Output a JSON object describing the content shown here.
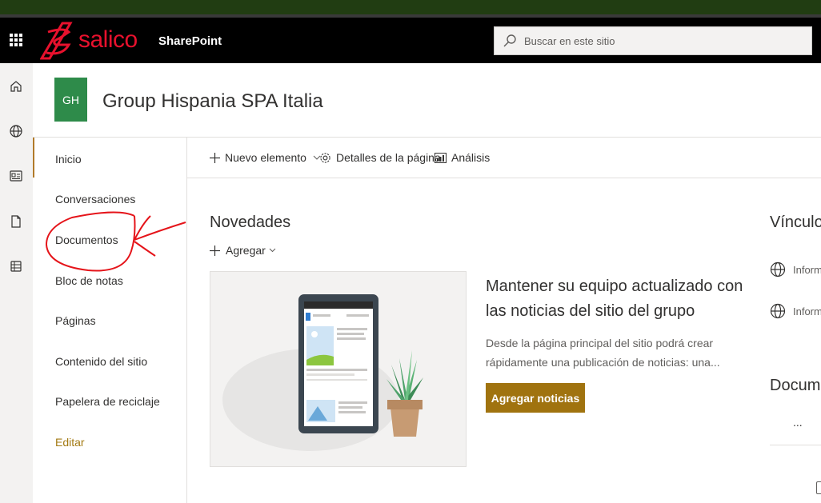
{
  "suite_bar": {
    "brand": "salico",
    "product": "SharePoint",
    "search_placeholder": "Buscar en este sitio",
    "brand_color": "#e8112d"
  },
  "app_bar": {
    "icons": [
      "home-icon",
      "globe-icon",
      "news-icon",
      "file-icon",
      "lists-icon"
    ]
  },
  "site": {
    "logo_initials": "GH",
    "title": "Group Hispania SPA Italia",
    "logo_color": "#2e8b4a"
  },
  "left_nav": {
    "items": [
      {
        "label": "Inicio",
        "selected": true
      },
      {
        "label": "Conversaciones"
      },
      {
        "label": "Documentos"
      },
      {
        "label": "Bloc de notas"
      },
      {
        "label": "Páginas"
      },
      {
        "label": "Contenido del sitio"
      },
      {
        "label": "Papelera de reciclaje"
      }
    ],
    "edit_label": "Editar",
    "accent_color": "#b17a2a"
  },
  "command_bar": {
    "new_item": "Nuevo elemento",
    "page_details": "Detalles de la página",
    "analytics": "Análisis"
  },
  "news": {
    "title": "Novedades",
    "add_label": "Agregar",
    "heading": "Mantener su equipo actualizado con las noticias del sitio del grupo",
    "description": "Desde la página principal del sitio podrá crear rápidamente una publicación de noticias: una...",
    "button_label": "Agregar noticias",
    "button_color": "#a0730f"
  },
  "quick_links": {
    "title": "Vínculos",
    "items": [
      "Inform",
      "Inform"
    ]
  },
  "documents": {
    "title": "Docume",
    "more": "..."
  }
}
